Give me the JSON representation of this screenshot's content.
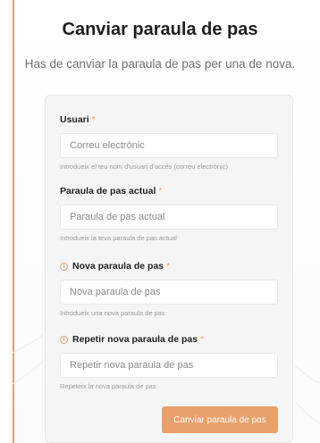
{
  "page": {
    "title": "Canviar paraula de pas",
    "subtitle": "Has de canviar la paraula de pas per una de nova."
  },
  "colors": {
    "accent": "#e9a06a",
    "card": "#f5f5f6"
  },
  "form": {
    "required_marker": "*",
    "user": {
      "label": "Usuari",
      "placeholder": "Correu electrònic",
      "help": "Introdueix el teu nom d'usuari d'accés (correu electrònic)"
    },
    "current_password": {
      "label": "Paraula de pas actual",
      "placeholder": "Paraula de pas actual",
      "help": "Introdueix la teva paraula de pas actual"
    },
    "new_password": {
      "icon": "info-circle-icon",
      "label": "Nova paraula de pas",
      "placeholder": "Nova paraula de pas",
      "help": "Introdueix una nova paraula de pas"
    },
    "repeat_password": {
      "icon": "info-circle-icon",
      "label": "Repetir nova paraula de pas",
      "placeholder": "Repetir nova paraula de pas",
      "help": "Repeteix la nova paraula de pas"
    },
    "submit_label": "Canviar paraula de pas"
  }
}
